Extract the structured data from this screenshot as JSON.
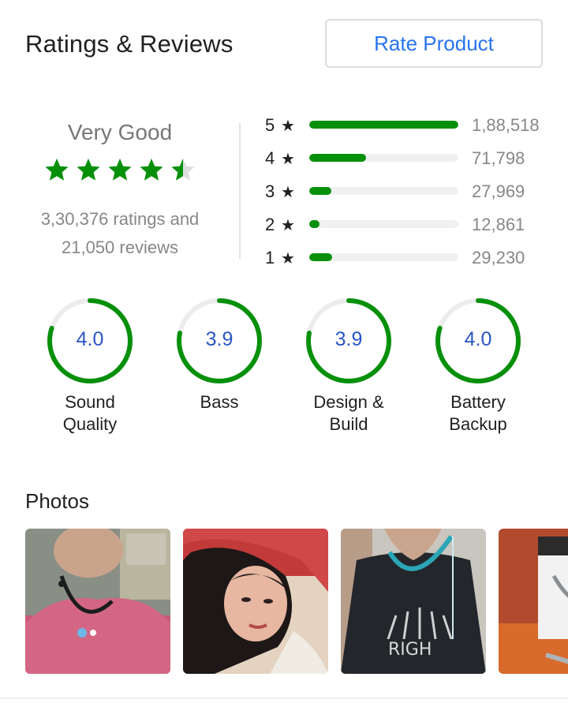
{
  "header": {
    "title": "Ratings & Reviews",
    "rate_button": "Rate Product"
  },
  "summary": {
    "label": "Very Good",
    "star_rating": 4.5,
    "ratings_text": "3,30,376 ratings and",
    "reviews_text": "21,050 reviews"
  },
  "histogram": [
    {
      "stars": "5",
      "count": "1,88,518",
      "fraction": 1.0
    },
    {
      "stars": "4",
      "count": "71,798",
      "fraction": 0.38
    },
    {
      "stars": "3",
      "count": "27,969",
      "fraction": 0.148
    },
    {
      "stars": "2",
      "count": "12,861",
      "fraction": 0.068
    },
    {
      "stars": "1",
      "count": "29,230",
      "fraction": 0.155
    }
  ],
  "aspects": [
    {
      "value": "4.0",
      "label_line1": "Sound",
      "label_line2": "Quality"
    },
    {
      "value": "3.9",
      "label_line1": "Bass",
      "label_line2": ""
    },
    {
      "value": "3.9",
      "label_line1": "Design &",
      "label_line2": "Build"
    },
    {
      "value": "4.0",
      "label_line1": "Battery",
      "label_line2": "Backup"
    }
  ],
  "photos": {
    "title": "Photos"
  },
  "colors": {
    "accent": "#2874f0",
    "green": "#06900a",
    "ring_value": "#2a55c5"
  }
}
